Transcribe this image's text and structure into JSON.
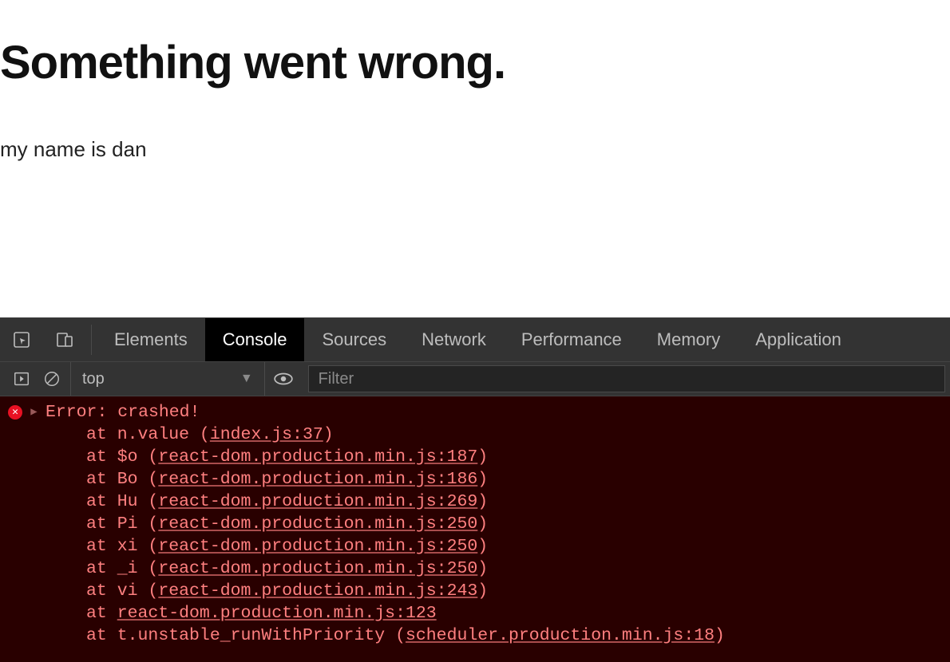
{
  "page": {
    "title": "Something went wrong.",
    "subtext": "my name is dan"
  },
  "devtools": {
    "tabs": [
      {
        "label": "Elements",
        "active": false
      },
      {
        "label": "Console",
        "active": true
      },
      {
        "label": "Sources",
        "active": false
      },
      {
        "label": "Network",
        "active": false
      },
      {
        "label": "Performance",
        "active": false
      },
      {
        "label": "Memory",
        "active": false
      },
      {
        "label": "Application",
        "active": false
      }
    ],
    "toolbar": {
      "context": "top",
      "filter_placeholder": "Filter"
    },
    "console": {
      "error_header": "Error: crashed!",
      "stack": [
        {
          "prefix": "at n.value (",
          "link": "index.js:37",
          "suffix": ")"
        },
        {
          "prefix": "at $o (",
          "link": "react-dom.production.min.js:187",
          "suffix": ")"
        },
        {
          "prefix": "at Bo (",
          "link": "react-dom.production.min.js:186",
          "suffix": ")"
        },
        {
          "prefix": "at Hu (",
          "link": "react-dom.production.min.js:269",
          "suffix": ")"
        },
        {
          "prefix": "at Pi (",
          "link": "react-dom.production.min.js:250",
          "suffix": ")"
        },
        {
          "prefix": "at xi (",
          "link": "react-dom.production.min.js:250",
          "suffix": ")"
        },
        {
          "prefix": "at _i (",
          "link": "react-dom.production.min.js:250",
          "suffix": ")"
        },
        {
          "prefix": "at vi (",
          "link": "react-dom.production.min.js:243",
          "suffix": ")"
        },
        {
          "prefix": "at ",
          "link": "react-dom.production.min.js:123",
          "suffix": ""
        },
        {
          "prefix": "at t.unstable_runWithPriority (",
          "link": "scheduler.production.min.js:18",
          "suffix": ")"
        }
      ]
    }
  }
}
